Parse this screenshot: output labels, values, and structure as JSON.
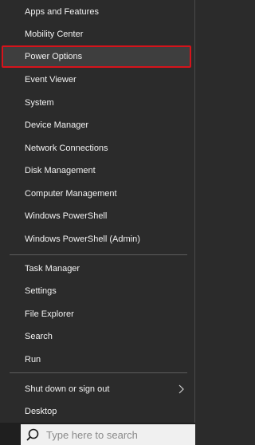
{
  "menu": {
    "items": [
      {
        "label": "Apps and Features"
      },
      {
        "label": "Mobility Center"
      },
      {
        "label": "Power Options",
        "highlighted": true
      },
      {
        "label": "Event Viewer"
      },
      {
        "label": "System"
      },
      {
        "label": "Device Manager"
      },
      {
        "label": "Network Connections"
      },
      {
        "label": "Disk Management"
      },
      {
        "label": "Computer Management"
      },
      {
        "label": "Windows PowerShell"
      },
      {
        "label": "Windows PowerShell (Admin)"
      },
      {
        "label": "Task Manager"
      },
      {
        "label": "Settings"
      },
      {
        "label": "File Explorer"
      },
      {
        "label": "Search"
      },
      {
        "label": "Run"
      },
      {
        "label": "Shut down or sign out",
        "submenu_icon": "chevron-right-icon"
      },
      {
        "label": "Desktop"
      }
    ]
  },
  "taskbar": {
    "search_placeholder": "Type here to search",
    "search_icon": "search-icon"
  },
  "colors": {
    "menu_background": "#2b2b2b",
    "highlight_border": "#d6131b",
    "text": "#f2f2f2"
  }
}
